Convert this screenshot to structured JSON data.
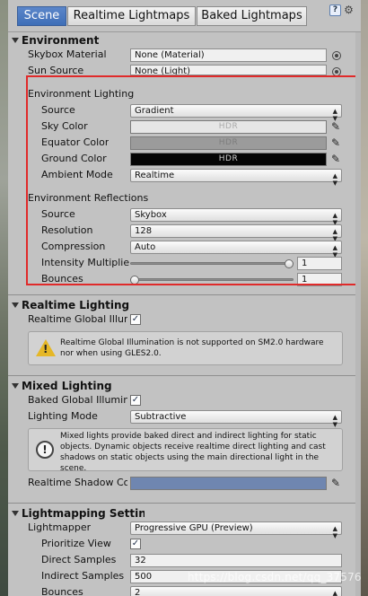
{
  "tabs": [
    {
      "label": "Scene"
    },
    {
      "label": "Realtime Lightmaps"
    },
    {
      "label": "Baked Lightmaps"
    }
  ],
  "toolbar": {
    "help_icon": "?",
    "gear_icon": "⚙"
  },
  "environment": {
    "title": "Environment",
    "skybox_label": "Skybox Material",
    "skybox_value": "None (Material)",
    "sun_label": "Sun Source",
    "sun_value": "None (Light)",
    "lighting_title": "Environment Lighting",
    "lighting_source_label": "Source",
    "lighting_source_value": "Gradient",
    "sky_color_label": "Sky Color",
    "sky_color_text": "HDR",
    "equator_color_label": "Equator Color",
    "equator_color_text": "HDR",
    "ground_color_label": "Ground Color",
    "ground_color_text": "HDR",
    "ambient_mode_label": "Ambient Mode",
    "ambient_mode_value": "Realtime",
    "reflections_title": "Environment Reflections",
    "refl_source_label": "Source",
    "refl_source_value": "Skybox",
    "resolution_label": "Resolution",
    "resolution_value": "128",
    "compression_label": "Compression",
    "compression_value": "Auto",
    "intensity_label": "Intensity Multiplier",
    "intensity_value": "1",
    "intensity_fraction": 1.0,
    "bounces_label": "Bounces",
    "bounces_value": "1",
    "bounces_fraction": 0.0
  },
  "colors": {
    "sky": "#e6e6e6",
    "equator": "#9b9b9b",
    "ground": "#050505",
    "highlight": "#e02a2a",
    "shadow": "#6f86b0"
  },
  "realtime_lighting": {
    "title": "Realtime Lighting",
    "gi_label": "Realtime Global Illumination",
    "gi_checked": true,
    "warning": "Realtime Global Illumination is not supported on SM2.0 hardware nor when using GLES2.0."
  },
  "mixed_lighting": {
    "title": "Mixed Lighting",
    "baked_gi_label": "Baked Global Illumination",
    "baked_gi_checked": true,
    "mode_label": "Lighting Mode",
    "mode_value": "Subtractive",
    "info": "Mixed lights provide baked direct and indirect lighting for static objects. Dynamic objects receive realtime direct lighting and cast shadows on static objects using the main directional light in the scene.",
    "shadow_color_label": "Realtime Shadow Color"
  },
  "lightmapping": {
    "title": "Lightmapping Settings",
    "lightmapper_label": "Lightmapper",
    "lightmapper_value": "Progressive GPU (Preview)",
    "prioritize_label": "Prioritize View",
    "prioritize_checked": true,
    "direct_label": "Direct Samples",
    "direct_value": "32",
    "indirect_label": "Indirect Samples",
    "indirect_value": "500",
    "bounces_label": "Bounces",
    "bounces_value": "2"
  },
  "watermark": "https://blog.csdn.net/qq_37576129"
}
